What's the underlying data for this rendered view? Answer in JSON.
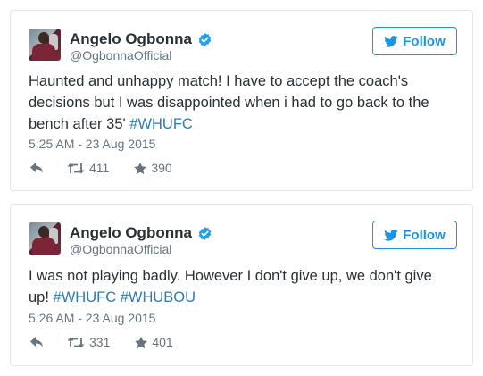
{
  "tweets": [
    {
      "author_name": "Angelo Ogbonna",
      "handle": "@OgbonnaOfficial",
      "follow_label": "Follow",
      "text_before": "Haunted and unhappy match! I have to accept the coach's decisions but I was disappointed when i had to go back to the bench after 35' ",
      "hashtags": [
        "#WHUFC"
      ],
      "timestamp": "5:25 AM - 23 Aug 2015",
      "retweets": "411",
      "likes": "390"
    },
    {
      "author_name": "Angelo Ogbonna",
      "handle": "@OgbonnaOfficial",
      "follow_label": "Follow",
      "text_before": "I was not playing badly. However I don't give up, we don't give up! ",
      "hashtags": [
        "#WHUFC",
        "#WHUBOU"
      ],
      "timestamp": "5:26 AM - 23 Aug 2015",
      "retweets": "331",
      "likes": "401"
    }
  ],
  "colors": {
    "accent": "#1b95e0",
    "hashtag": "#2b7bb9",
    "text": "#292f33",
    "muted": "#66757f",
    "border": "#e1e8ed"
  },
  "icons": {
    "verified": "verified-badge-icon",
    "follow": "twitter-bird-icon",
    "reply": "reply-icon",
    "retweet": "retweet-icon",
    "like": "star-icon"
  }
}
